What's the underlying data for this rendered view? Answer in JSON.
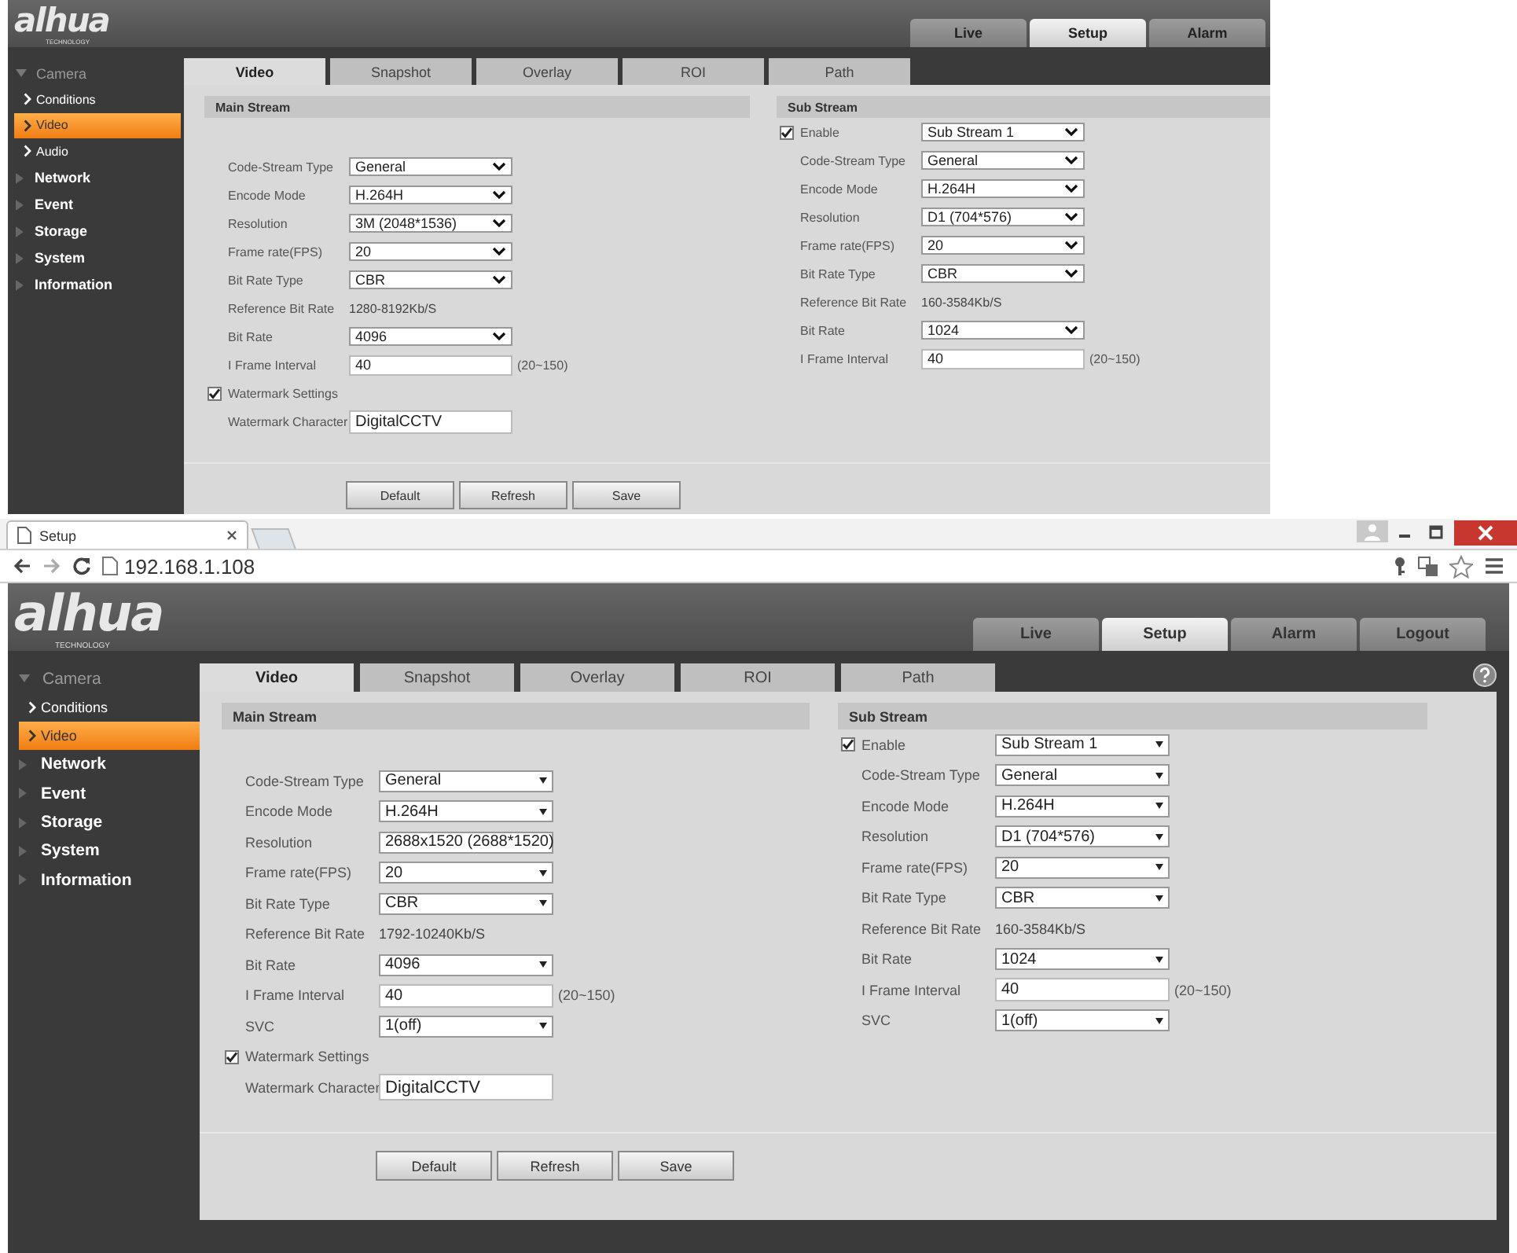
{
  "screens": [
    {
      "logo": {
        "text": "alhua",
        "tagline": "TECHNOLOGY"
      },
      "kind": "classic",
      "top_tabs": [
        {
          "label": "Live",
          "selected": false
        },
        {
          "label": "Setup",
          "selected": true
        },
        {
          "label": "Alarm",
          "selected": false
        }
      ],
      "sidebar": [
        {
          "label": "Camera",
          "expanded": true,
          "children": [
            {
              "label": "Conditions",
              "selected": false
            },
            {
              "label": "Video",
              "selected": true
            },
            {
              "label": "Audio",
              "selected": false
            }
          ]
        },
        {
          "label": "Network",
          "expanded": false
        },
        {
          "label": "Event",
          "expanded": false
        },
        {
          "label": "Storage",
          "expanded": false
        },
        {
          "label": "System",
          "expanded": false
        },
        {
          "label": "Information",
          "expanded": false
        }
      ],
      "tabs": [
        {
          "label": "Video",
          "selected": true
        },
        {
          "label": "Snapshot",
          "selected": false
        },
        {
          "label": "Overlay",
          "selected": false
        },
        {
          "label": "ROI",
          "selected": false
        },
        {
          "label": "Path",
          "selected": false
        }
      ],
      "main_stream": {
        "title": "Main Stream",
        "fields": [
          {
            "label": "Code-Stream Type",
            "kind": "select",
            "value": "General"
          },
          {
            "label": "Encode Mode",
            "kind": "select",
            "value": "H.264H"
          },
          {
            "label": "Resolution",
            "kind": "select",
            "value": "3M (2048*1536)"
          },
          {
            "label": "Frame rate(FPS)",
            "kind": "select",
            "value": "20"
          },
          {
            "label": "Bit Rate Type",
            "kind": "select",
            "value": "CBR"
          },
          {
            "label": "Reference Bit Rate",
            "kind": "text",
            "value": "1280-8192Kb/S"
          },
          {
            "label": "Bit Rate",
            "kind": "select",
            "value": "4096"
          },
          {
            "label": "I Frame Interval",
            "kind": "input",
            "value": "40",
            "hint": "(20~150)"
          }
        ],
        "watermark": {
          "label": "Watermark Settings",
          "checked": true,
          "character_label": "Watermark Character",
          "character_value": "DigitalCCTV"
        }
      },
      "sub_stream": {
        "title": "Sub Stream",
        "enable": {
          "label": "Enable",
          "checked": true,
          "value": "Sub Stream 1"
        },
        "fields": [
          {
            "label": "Code-Stream Type",
            "kind": "select",
            "value": "General"
          },
          {
            "label": "Encode Mode",
            "kind": "select",
            "value": "H.264H"
          },
          {
            "label": "Resolution",
            "kind": "select",
            "value": "D1 (704*576)"
          },
          {
            "label": "Frame rate(FPS)",
            "kind": "select",
            "value": "20"
          },
          {
            "label": "Bit Rate Type",
            "kind": "select",
            "value": "CBR"
          },
          {
            "label": "Reference Bit Rate",
            "kind": "text",
            "value": "160-3584Kb/S"
          },
          {
            "label": "Bit Rate",
            "kind": "select",
            "value": "1024"
          },
          {
            "label": "I Frame Interval",
            "kind": "input",
            "value": "40",
            "hint": "(20~150)"
          }
        ]
      },
      "buttons": [
        "Default",
        "Refresh",
        "Save"
      ]
    },
    {
      "browser": {
        "tab_title": "Setup",
        "url": "192.168.1.108"
      },
      "logo": {
        "text": "alhua",
        "tagline": "TECHNOLOGY"
      },
      "kind": "modern",
      "help": true,
      "top_tabs": [
        {
          "label": "Live",
          "selected": false
        },
        {
          "label": "Setup",
          "selected": true
        },
        {
          "label": "Alarm",
          "selected": false
        },
        {
          "label": "Logout",
          "selected": false
        }
      ],
      "sidebar": [
        {
          "label": "Camera",
          "expanded": true,
          "children": [
            {
              "label": "Conditions",
              "selected": false
            },
            {
              "label": "Video",
              "selected": true
            }
          ]
        },
        {
          "label": "Network",
          "expanded": false
        },
        {
          "label": "Event",
          "expanded": false
        },
        {
          "label": "Storage",
          "expanded": false
        },
        {
          "label": "System",
          "expanded": false
        },
        {
          "label": "Information",
          "expanded": false
        }
      ],
      "tabs": [
        {
          "label": "Video",
          "selected": true
        },
        {
          "label": "Snapshot",
          "selected": false
        },
        {
          "label": "Overlay",
          "selected": false
        },
        {
          "label": "ROI",
          "selected": false
        },
        {
          "label": "Path",
          "selected": false
        }
      ],
      "main_stream": {
        "title": "Main Stream",
        "fields": [
          {
            "label": "Code-Stream Type",
            "kind": "select",
            "value": "General"
          },
          {
            "label": "Encode Mode",
            "kind": "select",
            "value": "H.264H"
          },
          {
            "label": "Resolution",
            "kind": "select",
            "value": "2688x1520 (2688*1520)"
          },
          {
            "label": "Frame rate(FPS)",
            "kind": "select",
            "value": "20"
          },
          {
            "label": "Bit Rate Type",
            "kind": "select",
            "value": "CBR"
          },
          {
            "label": "Reference Bit Rate",
            "kind": "text",
            "value": "1792-10240Kb/S"
          },
          {
            "label": "Bit Rate",
            "kind": "select",
            "value": "4096"
          },
          {
            "label": "I Frame Interval",
            "kind": "input",
            "value": "40",
            "hint": "(20~150)"
          },
          {
            "label": "SVC",
            "kind": "select",
            "value": "1(off)"
          }
        ],
        "watermark": {
          "label": "Watermark Settings",
          "checked": true,
          "character_label": "Watermark Character",
          "character_value": "DigitalCCTV"
        }
      },
      "sub_stream": {
        "title": "Sub Stream",
        "enable": {
          "label": "Enable",
          "checked": true,
          "value": "Sub Stream 1"
        },
        "fields": [
          {
            "label": "Code-Stream Type",
            "kind": "select",
            "value": "General"
          },
          {
            "label": "Encode Mode",
            "kind": "select",
            "value": "H.264H"
          },
          {
            "label": "Resolution",
            "kind": "select",
            "value": "D1 (704*576)"
          },
          {
            "label": "Frame rate(FPS)",
            "kind": "select",
            "value": "20"
          },
          {
            "label": "Bit Rate Type",
            "kind": "select",
            "value": "CBR"
          },
          {
            "label": "Reference Bit Rate",
            "kind": "text",
            "value": "160-3584Kb/S"
          },
          {
            "label": "Bit Rate",
            "kind": "select",
            "value": "1024"
          },
          {
            "label": "I Frame Interval",
            "kind": "input",
            "value": "40",
            "hint": "(20~150)"
          },
          {
            "label": "SVC",
            "kind": "select",
            "value": "1(off)"
          }
        ]
      },
      "buttons": [
        "Default",
        "Refresh",
        "Save"
      ]
    }
  ]
}
